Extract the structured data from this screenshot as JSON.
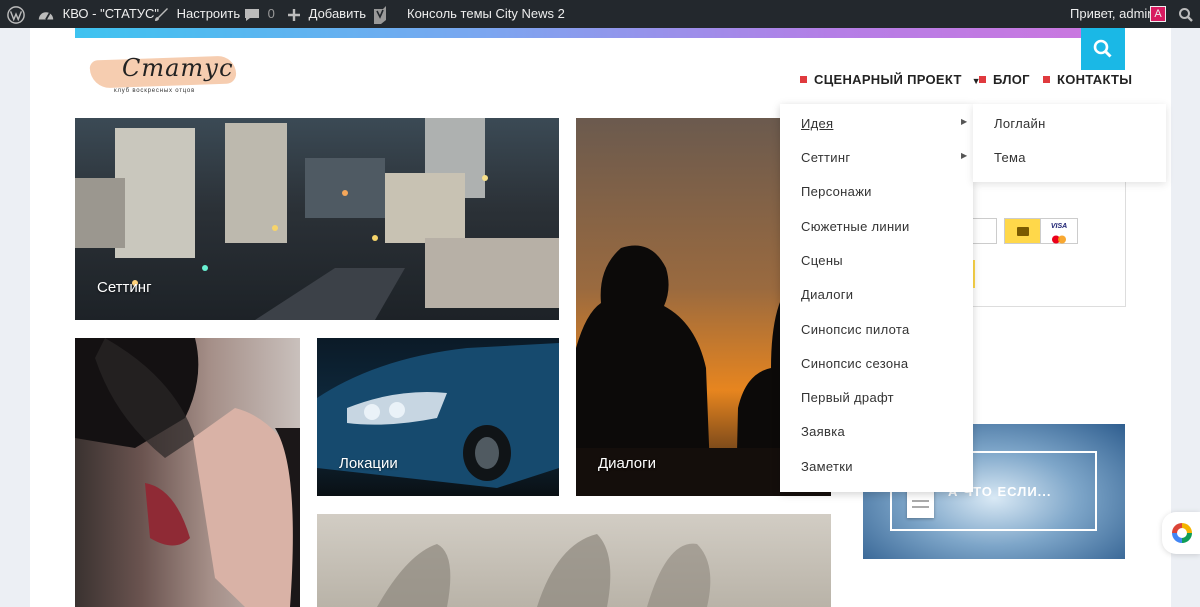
{
  "admin_bar": {
    "site_name": "КВО - \"СТАТУС\"",
    "customize": "Настроить",
    "comments_count": "0",
    "add_new": "Добавить",
    "theme_console": "Консоль темы City News 2",
    "greeting": "Привет, admin"
  },
  "logo": {
    "title": "Статус",
    "subtitle": "клуб воскресных отцов"
  },
  "nav": {
    "items": [
      {
        "label": "СЦЕНАРНЫЙ ПРОЕКТ"
      },
      {
        "label": "БЛОГ"
      },
      {
        "label": "КОНТАКТЫ"
      }
    ]
  },
  "dropdown": {
    "items": [
      {
        "label": "Идея"
      },
      {
        "label": "Сеттинг"
      },
      {
        "label": "Персонажи"
      },
      {
        "label": "Сюжетные линии"
      },
      {
        "label": "Сцены"
      },
      {
        "label": "Диалоги"
      },
      {
        "label": "Синопсис пилота"
      },
      {
        "label": "Синопсис сезона"
      },
      {
        "label": "Первый драфт"
      },
      {
        "label": "Заявка"
      },
      {
        "label": "Заметки"
      }
    ],
    "submenu": [
      {
        "label": "Логлайн"
      },
      {
        "label": "Тема"
      }
    ]
  },
  "cards": {
    "setting": "Сеттинг",
    "locations": "Локации",
    "dialogs": "Диалоги"
  },
  "sidebar": {
    "payment_visa": "VISA",
    "banner_text": "А ЧТО ЕСЛИ..."
  },
  "colors": {
    "accent": "#1ab8e6",
    "nav_marker": "#e03a3e",
    "admin_bar": "#23282d"
  }
}
